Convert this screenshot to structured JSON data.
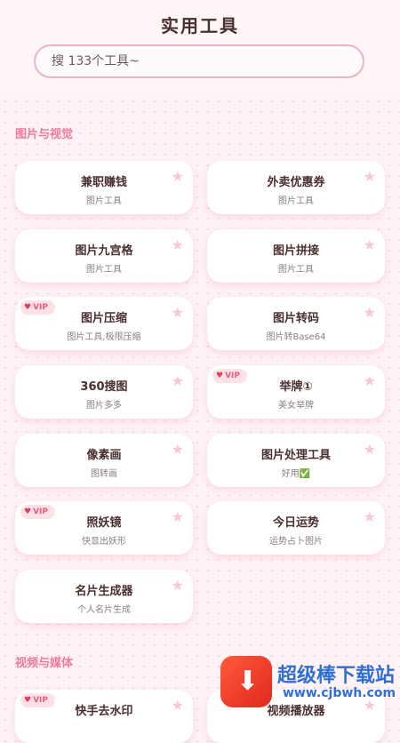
{
  "title": "实用工具",
  "search": {
    "placeholder": "搜 133个工具~"
  },
  "sections": [
    {
      "title": "图片与视觉",
      "tools": [
        {
          "name": "兼职赚钱",
          "subtitle": "图片工具",
          "vip": false
        },
        {
          "name": "外卖优惠券",
          "subtitle": "图片工具",
          "vip": false
        },
        {
          "name": "图片九宫格",
          "subtitle": "图片工具",
          "vip": false
        },
        {
          "name": "图片拼接",
          "subtitle": "图片工具",
          "vip": false
        },
        {
          "name": "图片压缩",
          "subtitle": "图片工具,极限压缩",
          "vip": true
        },
        {
          "name": "图片转码",
          "subtitle": "图片转Base64",
          "vip": false
        },
        {
          "name": "360搜图",
          "subtitle": "图片多多",
          "vip": false
        },
        {
          "name": "举牌①",
          "subtitle": "美女举牌",
          "vip": true
        },
        {
          "name": "像素画",
          "subtitle": "图转画",
          "vip": false
        },
        {
          "name": "图片处理工具",
          "subtitle": "好用✅",
          "vip": false
        },
        {
          "name": "照妖镜",
          "subtitle": "快显出妖形",
          "vip": true
        },
        {
          "name": "今日运势",
          "subtitle": "运势占卜图片",
          "vip": false
        },
        {
          "name": "名片生成器",
          "subtitle": "个人名片生成",
          "vip": false
        }
      ]
    },
    {
      "title": "视频与媒体",
      "tools": [
        {
          "name": "快手去水印",
          "subtitle": "",
          "vip": true
        },
        {
          "name": "视频播放器",
          "subtitle": "",
          "vip": false
        }
      ]
    }
  ],
  "vip_label": "VIP",
  "watermark": {
    "brand": "超级棒下载站",
    "url": "www.cjbwh.com"
  },
  "colors": {
    "accent": "#f07a9a",
    "background": "#fff3f6",
    "card": "#ffffff",
    "star": "#f9c6d3"
  }
}
